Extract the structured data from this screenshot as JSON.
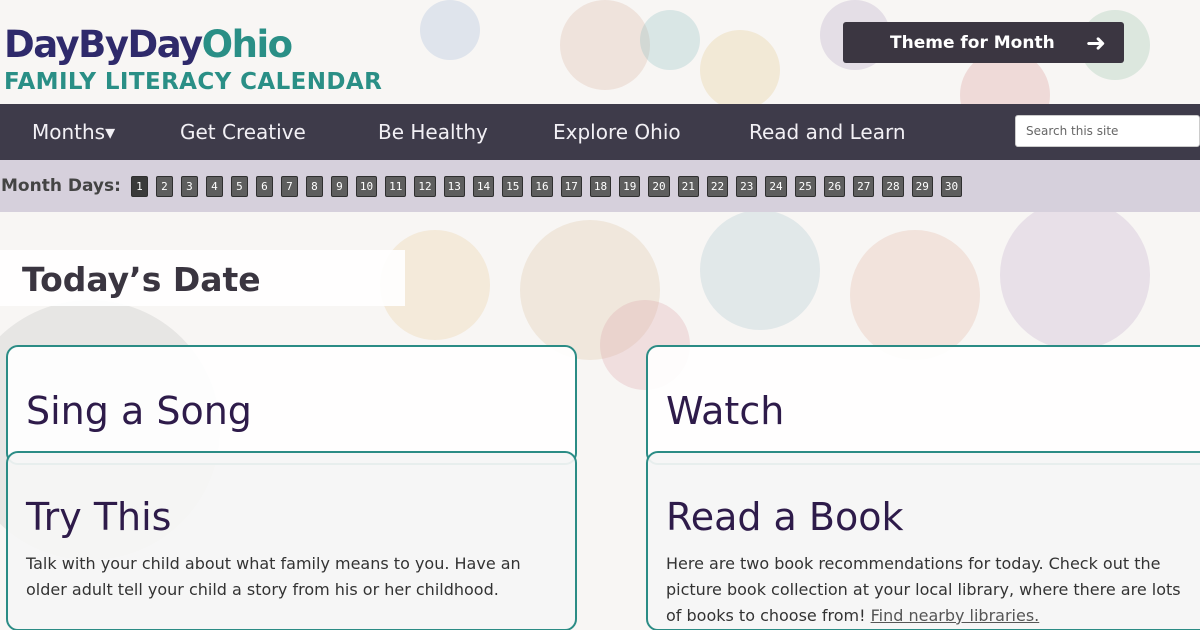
{
  "logo": {
    "name_part1": "DayByDay",
    "name_part2": "Ohio",
    "tagline": "FAMILY LITERACY CALENDAR"
  },
  "theme_button": {
    "label": "Theme for Month",
    "icon": "arrow-right-icon"
  },
  "nav": {
    "items": [
      {
        "label": "Months▾"
      },
      {
        "label": "Get Creative"
      },
      {
        "label": "Be Healthy"
      },
      {
        "label": "Explore Ohio"
      },
      {
        "label": "Read and Learn"
      }
    ],
    "search_placeholder": "Search this site"
  },
  "month_days": {
    "label": "Month Days:",
    "days": [
      "1",
      "2",
      "3",
      "4",
      "5",
      "6",
      "7",
      "8",
      "9",
      "10",
      "11",
      "12",
      "13",
      "14",
      "15",
      "16",
      "17",
      "18",
      "19",
      "20",
      "21",
      "22",
      "23",
      "24",
      "25",
      "26",
      "27",
      "28",
      "29",
      "30"
    ],
    "active_day": "1"
  },
  "today": {
    "title": "Today’s Date"
  },
  "cards": {
    "sing": {
      "title": "Sing a Song"
    },
    "watch": {
      "title": "Watch"
    },
    "try": {
      "title": "Try This",
      "body": "Talk with your child about what family means to you. Have an older adult tell your child a story from his or her childhood."
    },
    "read": {
      "title": "Read a Book",
      "body": "Here are two book recommendations for today. Check out the picture book collection at your local library, where there are lots of books to choose from! ",
      "link": "Find nearby libraries."
    }
  },
  "colors": {
    "nav_bg": "#3e3b4a",
    "days_bar_bg": "#d6d0dc",
    "card_border": "#2b8c85",
    "logo_purple": "#2f2a6b",
    "logo_teal": "#2a8f86",
    "title_purple": "#2e1b4a"
  }
}
